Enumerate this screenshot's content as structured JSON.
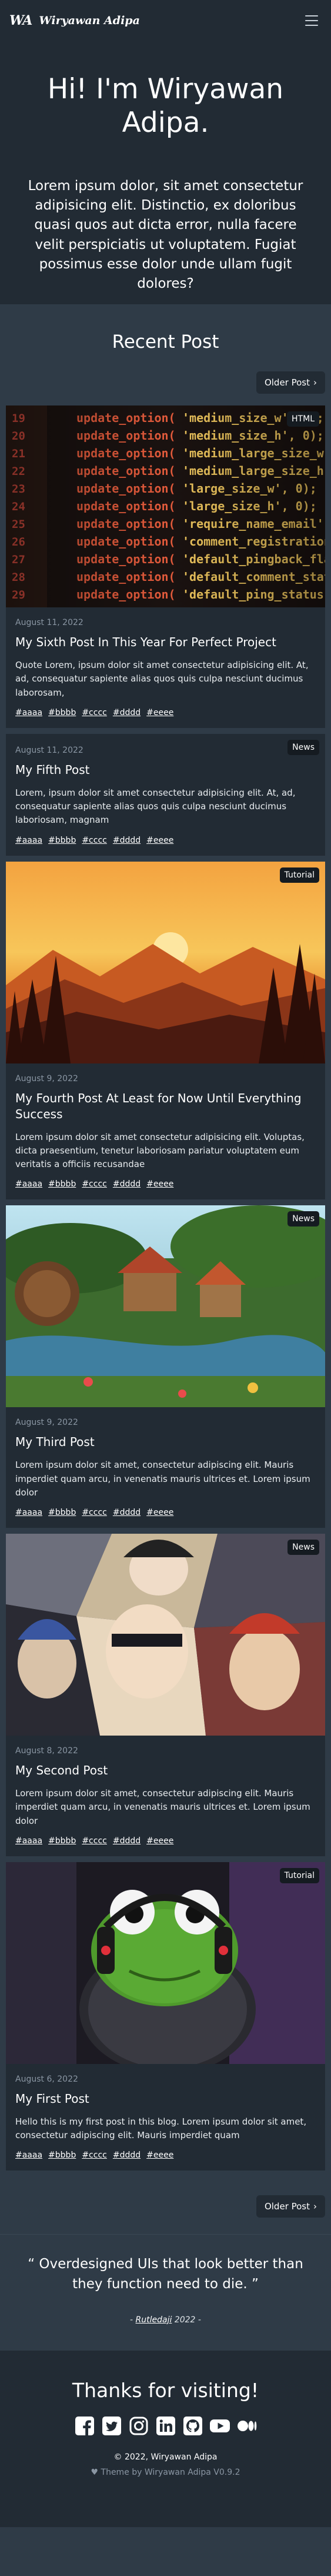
{
  "nav": {
    "logo": "WA",
    "brand": "Wiryawan Adipa"
  },
  "hero": {
    "title": "Hi! I'm Wiryawan Adipa.",
    "text": "Lorem ipsum dolor, sit amet consectetur adipisicing elit. Distinctio, ex doloribus quasi quos aut dicta error, nulla facere velit perspiciatis ut voluptatem. Fugiat possimus esse dolor unde ullam fugit dolores?"
  },
  "recent": {
    "title": "Recent Post",
    "older_label": "Older Post",
    "older_chevron": "›"
  },
  "posts": [
    {
      "badge": "HTML",
      "date": "August 11, 2022",
      "title": "My Sixth Post In This Year For Perfect Project",
      "text": "Quote Lorem, ipsum dolor sit amet consectetur adipisicing elit. At, ad, consequatur sapiente alias quos quis culpa nesciunt ducimus laborosam,",
      "tags": [
        "#aaaa",
        "#bbbb",
        "#cccc",
        "#dddd",
        "#eeee"
      ],
      "image": "code-screen"
    },
    {
      "badge": "News",
      "date": "August 11, 2022",
      "title": "My Fifth Post",
      "text": "Lorem, ipsum dolor sit amet consectetur adipisicing elit. At, ad, consequatur sapiente alias quos quis culpa nesciunt ducimus laboriosam, magnam",
      "tags": [
        "#aaaa",
        "#bbbb",
        "#cccc",
        "#dddd",
        "#eeee"
      ],
      "image": null
    },
    {
      "badge": "Tutorial",
      "date": "August 9, 2022",
      "title": "My Fourth Post At Least for Now Until Everything Success",
      "text": "Lorem ipsum dolor sit amet consectetur adipisicing elit. Voluptas, dicta praesentium, tenetur laboriosam pariatur voluptatem eum veritatis a officiis recusandae",
      "tags": [
        "#aaaa",
        "#bbbb",
        "#cccc",
        "#dddd",
        "#eeee"
      ],
      "image": "sunset-forest"
    },
    {
      "badge": "News",
      "date": "August 9, 2022",
      "title": "My Third Post",
      "text": "Lorem ipsum dolor sit amet, consectetur adipiscing elit. Mauris imperdiet quam arcu, in venenatis mauris ultrices et. Lorem ipsum dolor",
      "tags": [
        "#aaaa",
        "#bbbb",
        "#cccc",
        "#dddd",
        "#eeee"
      ],
      "image": "fantasy-village"
    },
    {
      "badge": "News",
      "date": "August 8, 2022",
      "title": "My Second Post",
      "text": "Lorem ipsum dolor sit amet, consectetur adipiscing elit. Mauris imperdiet quam arcu, in venenatis mauris ultrices et. Lorem ipsum dolor",
      "tags": [
        "#aaaa",
        "#bbbb",
        "#cccc",
        "#dddd",
        "#eeee"
      ],
      "image": "anime-collage"
    },
    {
      "badge": "Tutorial",
      "date": "August 6, 2022",
      "title": "My First Post",
      "text": "Hello this is my first post in this blog. Lorem ipsum dolor sit amet, consectetur adipiscing elit. Mauris imperdiet quam",
      "tags": [
        "#aaaa",
        "#bbbb",
        "#cccc",
        "#dddd",
        "#eeee"
      ],
      "image": "frog-plush"
    }
  ],
  "quote": {
    "text": "“ Overdesigned UIs that look better than they function need to die. ”",
    "dash_pre": "- ",
    "author": "Rutledaji",
    "dash_post": " 2022 -"
  },
  "footer": {
    "thanks": "Thanks for visiting!",
    "socials": [
      "facebook-icon",
      "twitter-icon",
      "instagram-icon",
      "linkedin-icon",
      "github-icon",
      "youtube-icon",
      "medium-icon"
    ],
    "copyright": "© 2022, Wiryawan Adipa",
    "theme": "Theme by Wiryawan Adipa V0.9.2",
    "theme_icon": "heart-icon"
  },
  "colors": {
    "bg_dark": "#222b34",
    "bg_mid": "#2f3b47",
    "muted": "#8a96a3"
  }
}
